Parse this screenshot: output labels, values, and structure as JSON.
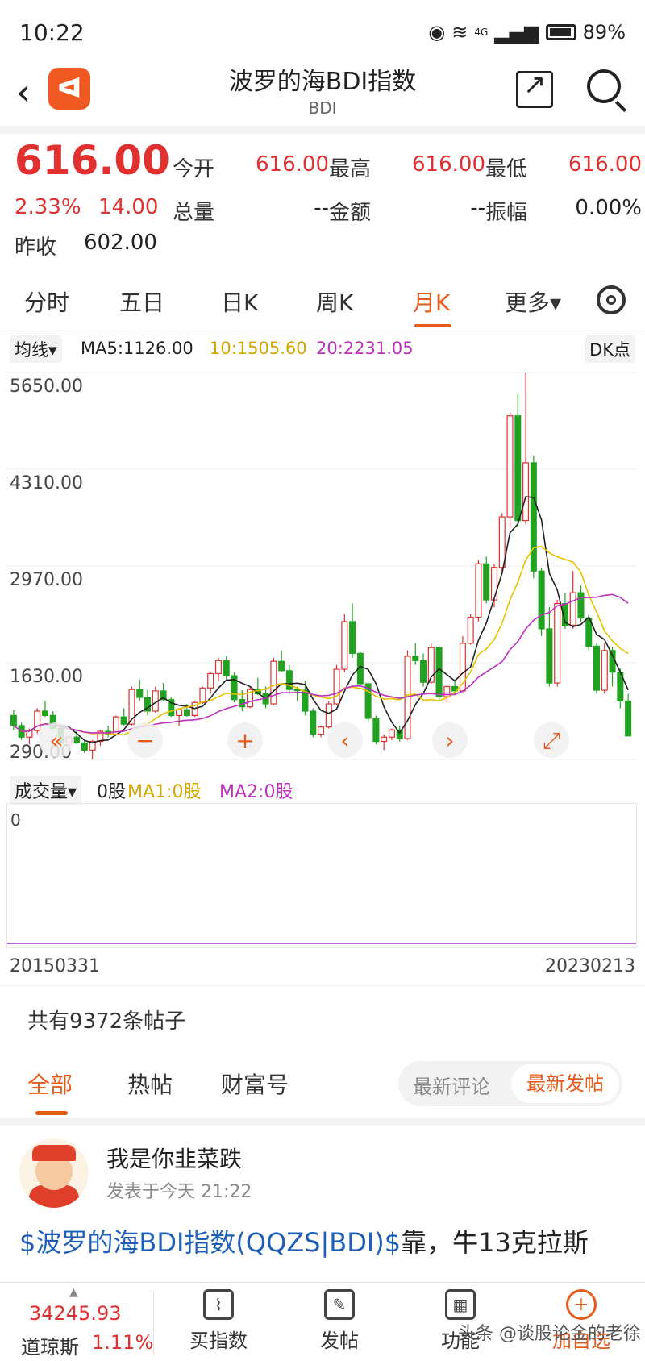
{
  "status": {
    "time": "10:22",
    "battery": "89%",
    "network": "4G"
  },
  "nav": {
    "title": "波罗的海BDI指数",
    "subtitle": "BDI"
  },
  "quote": {
    "price": "616.00",
    "change_pct": "2.33%",
    "change_amt": "14.00",
    "prev_close_label": "昨收",
    "prev_close": "602.00",
    "rows": [
      [
        {
          "label": "今开",
          "value": "616.00"
        },
        {
          "label": "最高",
          "value": "616.00"
        },
        {
          "label": "最低",
          "value": "616.00"
        }
      ],
      [
        {
          "label": "总量",
          "value": "--"
        },
        {
          "label": "金额",
          "value": "--"
        },
        {
          "label": "振幅",
          "value": "0.00%"
        }
      ]
    ]
  },
  "tabs": [
    "分时",
    "五日",
    "日K",
    "周K",
    "月K",
    "更多▾"
  ],
  "active_tab": "月K",
  "ma": {
    "selector": "均线▾",
    "ma5": "MA5:1126.00",
    "ma10": "10:1505.60",
    "ma20": "20:2231.05",
    "dk_button": "DK点"
  },
  "colors": {
    "up": "#e03030",
    "down": "#21a321",
    "ma5": "#222222",
    "ma10": "#e6c200",
    "ma20": "#c030c0",
    "accent": "#e65b1a"
  },
  "chart_data": {
    "type": "candlestick",
    "y_ticks": [
      "5650.00",
      "4310.00",
      "2970.00",
      "1630.00",
      "290.00"
    ],
    "ylim": [
      290,
      5650
    ],
    "x_start": "20150331",
    "x_end": "20230213",
    "ma_series": [
      {
        "name": "MA5",
        "color": "#222222"
      },
      {
        "name": "MA10",
        "color": "#e6c200"
      },
      {
        "name": "MA20",
        "color": "#c030c0"
      }
    ],
    "candles_ohlc": [
      [
        900,
        980,
        700,
        760
      ],
      [
        760,
        800,
        560,
        600
      ],
      [
        600,
        720,
        500,
        690
      ],
      [
        690,
        1000,
        650,
        960
      ],
      [
        960,
        1100,
        880,
        900
      ],
      [
        900,
        960,
        700,
        720
      ],
      [
        720,
        760,
        480,
        520
      ],
      [
        520,
        620,
        420,
        600
      ],
      [
        600,
        700,
        500,
        520
      ],
      [
        520,
        560,
        380,
        420
      ],
      [
        420,
        560,
        300,
        540
      ],
      [
        540,
        700,
        480,
        680
      ],
      [
        680,
        760,
        600,
        640
      ],
      [
        640,
        900,
        620,
        880
      ],
      [
        880,
        1000,
        760,
        780
      ],
      [
        780,
        1300,
        760,
        1260
      ],
      [
        1260,
        1400,
        1100,
        1150
      ],
      [
        1150,
        1260,
        900,
        960
      ],
      [
        960,
        1300,
        940,
        1240
      ],
      [
        1240,
        1350,
        1100,
        1120
      ],
      [
        1120,
        1150,
        880,
        900
      ],
      [
        900,
        1000,
        760,
        980
      ],
      [
        980,
        1060,
        880,
        900
      ],
      [
        900,
        1100,
        880,
        1080
      ],
      [
        1080,
        1300,
        1060,
        1280
      ],
      [
        1280,
        1500,
        1200,
        1480
      ],
      [
        1480,
        1700,
        1380,
        1660
      ],
      [
        1660,
        1720,
        1400,
        1450
      ],
      [
        1450,
        1500,
        1080,
        1120
      ],
      [
        1120,
        1250,
        960,
        1020
      ],
      [
        1020,
        1300,
        1000,
        1260
      ],
      [
        1260,
        1420,
        1180,
        1200
      ],
      [
        1200,
        1300,
        1000,
        1060
      ],
      [
        1060,
        1700,
        1040,
        1650
      ],
      [
        1650,
        1800,
        1500,
        1520
      ],
      [
        1520,
        1600,
        1200,
        1260
      ],
      [
        1260,
        1300,
        1100,
        1250
      ],
      [
        1250,
        1380,
        900,
        960
      ],
      [
        960,
        1000,
        600,
        640
      ],
      [
        640,
        760,
        600,
        740
      ],
      [
        740,
        1100,
        720,
        1060
      ],
      [
        1060,
        1600,
        1040,
        1540
      ],
      [
        1540,
        2300,
        1500,
        2200
      ],
      [
        2200,
        2450,
        1700,
        1760
      ],
      [
        1760,
        1780,
        1300,
        1340
      ],
      [
        1340,
        1360,
        800,
        860
      ],
      [
        860,
        900,
        500,
        540
      ],
      [
        540,
        640,
        420,
        600
      ],
      [
        600,
        720,
        560,
        700
      ],
      [
        700,
        760,
        540,
        580
      ],
      [
        580,
        1800,
        560,
        1720
      ],
      [
        1720,
        1900,
        1600,
        1660
      ],
      [
        1660,
        1760,
        1300,
        1360
      ],
      [
        1360,
        1900,
        1340,
        1840
      ],
      [
        1840,
        1860,
        1100,
        1160
      ],
      [
        1160,
        1320,
        1080,
        1300
      ],
      [
        1300,
        1400,
        1200,
        1240
      ],
      [
        1240,
        2000,
        1220,
        1900
      ],
      [
        1900,
        2300,
        1880,
        2260
      ],
      [
        2260,
        3050,
        2200,
        3000
      ],
      [
        3000,
        3100,
        2450,
        2500
      ],
      [
        2500,
        3000,
        2400,
        2950
      ],
      [
        2950,
        3700,
        2900,
        3650
      ],
      [
        3650,
        5100,
        3500,
        5050
      ],
      [
        5050,
        5350,
        3500,
        3600
      ],
      [
        3600,
        5650,
        3550,
        4400
      ],
      [
        4400,
        4500,
        2800,
        2900
      ],
      [
        2900,
        2950,
        2000,
        2100
      ],
      [
        2100,
        2400,
        1300,
        1350
      ],
      [
        1350,
        2500,
        1300,
        2450
      ],
      [
        2450,
        2600,
        2100,
        2150
      ],
      [
        2150,
        2900,
        2100,
        2600
      ],
      [
        2600,
        2700,
        2200,
        2250
      ],
      [
        2250,
        2300,
        1800,
        1860
      ],
      [
        1860,
        1900,
        1200,
        1250
      ],
      [
        1250,
        1900,
        1200,
        1800
      ],
      [
        1800,
        1850,
        1300,
        1500
      ],
      [
        1500,
        1550,
        1000,
        1100
      ],
      [
        1100,
        1200,
        616,
        616
      ]
    ]
  },
  "volume": {
    "selector": "成交量▾",
    "value": "0股",
    "ma1": "MA1:0股",
    "ma2": "MA2:0股",
    "axis_zero": "0"
  },
  "dates": {
    "start": "20150331",
    "end": "20230213"
  },
  "posts": {
    "count_text": "共有9372条帖子",
    "tabs": [
      "全部",
      "热帖",
      "财富号"
    ],
    "active_tab": "全部",
    "sort_latest_comment": "最新评论",
    "sort_latest_post": "最新发帖",
    "first": {
      "author": "我是你韭菜跌",
      "time": "发表于今天 21:22",
      "body_link": "$波罗的海BDI指数(QQZS|BDI)$",
      "body_text": "靠，牛13克拉斯"
    }
  },
  "bottom": {
    "index_value": "34245.93",
    "index_name": "道琼斯",
    "index_change": "1.11%",
    "items": [
      {
        "label": "买指数",
        "icon": "chart-icon"
      },
      {
        "label": "发帖",
        "icon": "edit-icon"
      },
      {
        "label": "功能",
        "icon": "grid-icon"
      },
      {
        "label": "加自选",
        "icon": "plus-icon"
      }
    ],
    "watermark": "头条 @谈股论金的老徐"
  }
}
